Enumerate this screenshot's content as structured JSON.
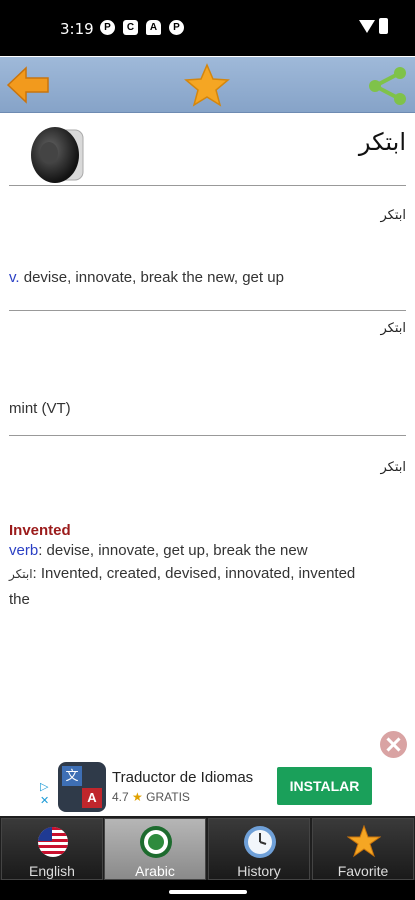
{
  "status_bar": {
    "time": "3:19",
    "notification_icons": [
      "p-icon",
      "clipboard-icon",
      "android-icon",
      "p-icon"
    ],
    "system_icons": [
      "wifi-icon",
      "battery-icon"
    ]
  },
  "toolbar": {
    "back_icon": "arrow-left-icon",
    "favorite_icon": "star-icon",
    "share_icon": "share-icon",
    "accent_color": "#f29a1d"
  },
  "header": {
    "word": "ابتكر",
    "speaker_icon": "speaker-icon"
  },
  "entries": [
    {
      "arabic": "ابتكر",
      "pos": "v.",
      "text": " devise, innovate, break the new, get up"
    },
    {
      "arabic": "ابتكر",
      "text": "mint (VT)"
    },
    {
      "arabic": "ابتكر",
      "title": "Invented",
      "pos": "verb",
      "text": ": devise, innovate, get up, break the new",
      "arabic_prefix": "ابتكر",
      "text2": ": Invented, created, devised, innovated, invented",
      "text3": "the"
    }
  ],
  "ad": {
    "close_icon": "close-icon",
    "adchoices": "▷\n✕",
    "app_icon_glyph1": "文",
    "app_icon_glyph2": "A",
    "app_name": "Traductor de Idiomas",
    "rating": "4.7",
    "rating_star": "★",
    "price": "GRATIS",
    "install_label": "INSTALAR",
    "install_color": "#1aa05a"
  },
  "tabs": [
    {
      "label": "English",
      "icon": "us-flag-icon",
      "active": false
    },
    {
      "label": "Arabic",
      "icon": "arab-league-emblem-icon",
      "active": true
    },
    {
      "label": "History",
      "icon": "clock-icon",
      "active": false
    },
    {
      "label": "Favorite",
      "icon": "star-icon",
      "active": false
    }
  ]
}
